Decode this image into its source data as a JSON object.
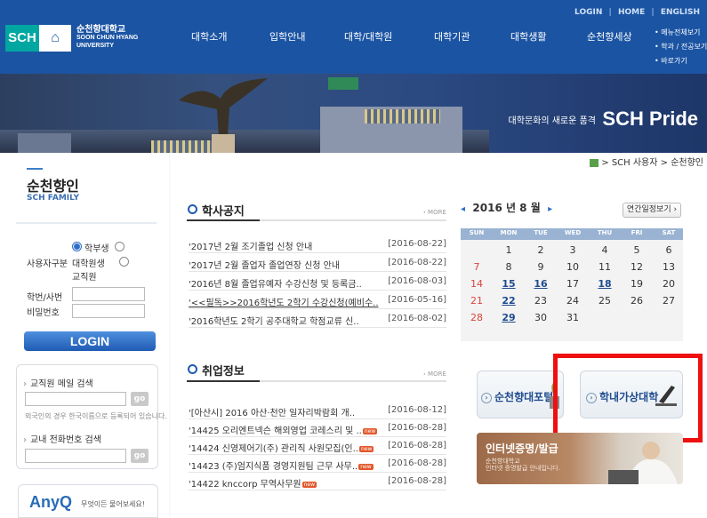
{
  "header": {
    "util": [
      "LOGIN",
      "|",
      "HOME",
      "|",
      "ENGLISH"
    ],
    "logo": {
      "mark": "SCH",
      "name_ko": "순천향대학교",
      "name_en1": "SOON CHUN HYANG",
      "name_en2": "UNIVERSITY"
    },
    "nav": [
      "대학소개",
      "입학안내",
      "대학/대학원",
      "대학기관",
      "대학생활",
      "순천향세상"
    ],
    "quick_links": [
      "• 메뉴전체보기",
      "• 학과 / 전공보기",
      "• 바로가기"
    ]
  },
  "banner": {
    "small": "대학문화의 새로운 품격",
    "big": "SCH Pride",
    "building_sign": "순천향대학"
  },
  "sidebar": {
    "title": "순천향인",
    "subtitle": "SCH FAMILY",
    "login": {
      "user_type_label": "사용자구분",
      "types": [
        "학부생",
        "대학원생",
        "교직원"
      ],
      "id_label": "학번/사번",
      "pw_label": "비밀번호",
      "button": "LOGIN"
    },
    "search": {
      "email_label": "교직원 메일 검색",
      "go": "go",
      "note": "외국인의 경우 한국이름으로 등록되어 있습니다.",
      "phone_label": "교내 전화번호 검색"
    },
    "anyq": {
      "big": "AnyQ",
      "small": "무엇이든 물어보세요!"
    }
  },
  "breadcrumb": "> SCH 사용자 > 순천향인",
  "notices": {
    "title": "학사공지",
    "more": "› MORE",
    "items": [
      {
        "title": "'2017년 2월 조기졸업 신청 안내",
        "date": "[2016-08-22]"
      },
      {
        "title": "'2017년 2월 졸업자 졸업연장 신청 안내",
        "date": "[2016-08-22]"
      },
      {
        "title": "'2016년 8월 졸업유예자 수강신청 및 등록금..",
        "date": "[2016-08-03]"
      },
      {
        "title": "'<<필독>>2016학년도 2학기 수강신청(예비수..",
        "date": "[2016-05-16]"
      },
      {
        "title": "'2016학년도 2학기 공주대학교 학점교류 신..",
        "date": "[2016-08-02]"
      }
    ]
  },
  "jobs": {
    "title": "취업정보",
    "more": "› MORE",
    "new_badge": "new",
    "items": [
      {
        "title": "'[아산시] 2016 아산·천안 일자리박람회 개..",
        "date": "[2016-08-12]",
        "new": false
      },
      {
        "title": "'14425 오리엔트넥슨 해외영업 코레스리 및 ..",
        "date": "[2016-08-28]",
        "new": true
      },
      {
        "title": "'14424 신영제어기(주) 관리직 사원모집(인..",
        "date": "[2016-08-28]",
        "new": true
      },
      {
        "title": "'14423 (주)엄지식품 경영지원팀 근무 사무..",
        "date": "[2016-08-28]",
        "new": true
      },
      {
        "title": "'14422 knccorp 무역사무원",
        "date": "[2016-08-28]",
        "new": true
      }
    ]
  },
  "calendar": {
    "prev": "◂",
    "next": "▸",
    "month_label": "2016 년 8 월",
    "view_button": "연간일정보기 ›",
    "days_of_week": [
      "SUN",
      "MON",
      "TUE",
      "WED",
      "THU",
      "FRI",
      "SAT"
    ],
    "weeks": [
      [
        "",
        "1",
        "2",
        "3",
        "4",
        "5",
        "6"
      ],
      [
        "7",
        "8",
        "9",
        "10",
        "11",
        "12",
        "13"
      ],
      [
        "14",
        "15",
        "16",
        "17",
        "18",
        "19",
        "20"
      ],
      [
        "21",
        "22",
        "23",
        "24",
        "25",
        "26",
        "27"
      ],
      [
        "28",
        "29",
        "30",
        "31",
        "",
        "",
        ""
      ]
    ],
    "linked_days": [
      "15",
      "16",
      "18",
      "22",
      "29"
    ],
    "sunday_color": "#d9443a",
    "link_color": "#1f4c8f"
  },
  "quick_banners": {
    "portal": "순천향대포털",
    "cyber": "학내가상대학"
  },
  "cert": {
    "title": "인터넷증명/발급",
    "sub1": "순천향대학교",
    "sub2": "인터넷 증명발급 안내입니다."
  },
  "colors": {
    "header_blue": "#1b54a3",
    "logo_teal": "#00a7a1",
    "highlight_red": "#ee1010"
  }
}
